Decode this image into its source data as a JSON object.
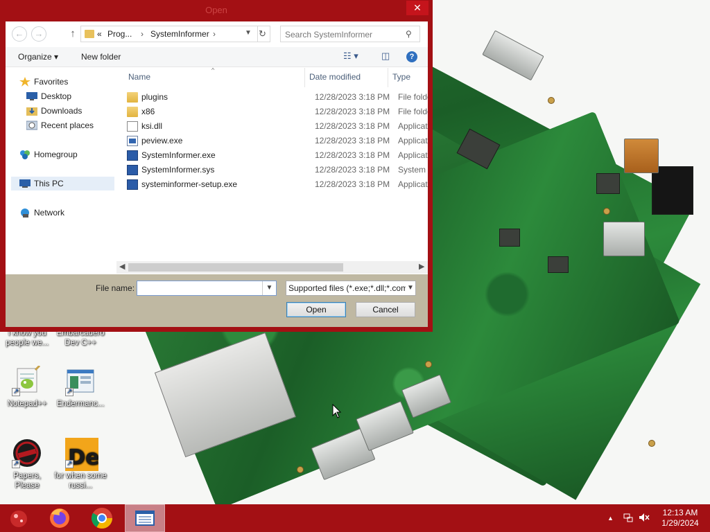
{
  "dialog": {
    "title": "Open",
    "close_label": "✕",
    "nav": {
      "back": "←",
      "forward": "→",
      "up": "↑"
    },
    "address": {
      "prefix": "«",
      "crumbs": [
        "Prog...",
        "SystemInformer"
      ],
      "separator": "›"
    },
    "search_placeholder": "Search SystemInformer",
    "toolbar": {
      "organize": "Organize ▾",
      "new_folder": "New folder"
    },
    "navpane": [
      {
        "label": "Favorites",
        "icon": "star-icon"
      },
      {
        "label": "Desktop",
        "icon": "desktop-icon"
      },
      {
        "label": "Downloads",
        "icon": "downloads-icon"
      },
      {
        "label": "Recent places",
        "icon": "recent-places-icon"
      },
      {
        "label": "Homegroup",
        "icon": "homegroup-icon"
      },
      {
        "label": "This PC",
        "icon": "this-pc-icon",
        "selected": true
      },
      {
        "label": "Network",
        "icon": "network-icon"
      }
    ],
    "columns": {
      "name": "Name",
      "date": "Date modified",
      "type": "Type"
    },
    "files": [
      {
        "name": "plugins",
        "date": "12/28/2023 3:18 PM",
        "type": "File folder",
        "icon": "folder"
      },
      {
        "name": "x86",
        "date": "12/28/2023 3:18 PM",
        "type": "File folder",
        "icon": "folder"
      },
      {
        "name": "ksi.dll",
        "date": "12/28/2023 3:18 PM",
        "type": "Application extension",
        "icon": "dll"
      },
      {
        "name": "peview.exe",
        "date": "12/28/2023 3:18 PM",
        "type": "Application",
        "icon": "exe"
      },
      {
        "name": "SystemInformer.exe",
        "date": "12/28/2023 3:18 PM",
        "type": "Application",
        "icon": "app"
      },
      {
        "name": "SystemInformer.sys",
        "date": "12/28/2023 3:18 PM",
        "type": "System file",
        "icon": "app"
      },
      {
        "name": "systeminformer-setup.exe",
        "date": "12/28/2023 3:18 PM",
        "type": "Application",
        "icon": "app"
      }
    ],
    "file_name_label": "File name:",
    "file_name_value": "",
    "filter": "Supported files (*.exe;*.dll;*.com",
    "open_label": "Open",
    "cancel_label": "Cancel"
  },
  "desktop_icons": [
    {
      "label": "I know you people we...",
      "icon": "text-file-icon"
    },
    {
      "label": "Embarcadero Dev C++",
      "icon": "devcpp-icon"
    },
    {
      "label": "Notepad++",
      "icon": "notepadpp-icon"
    },
    {
      "label": "Endermanc...",
      "icon": "endermanch-icon"
    },
    {
      "label": "Papers, Please",
      "icon": "papers-please-icon"
    },
    {
      "label": "for when some russi...",
      "icon": "de-icon"
    }
  ],
  "taskbar": {
    "apps": [
      {
        "name": "custom-app-icon"
      },
      {
        "name": "firefox-icon"
      },
      {
        "name": "chrome-icon"
      },
      {
        "name": "explorer-window-icon",
        "active": true
      }
    ],
    "time": "12:13 AM",
    "date": "1/29/2024"
  }
}
